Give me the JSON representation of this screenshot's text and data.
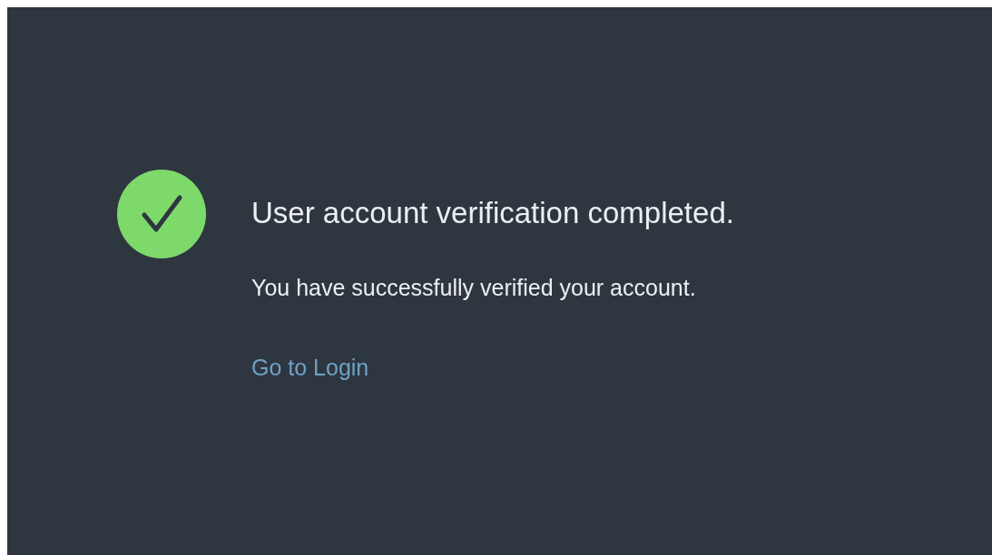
{
  "status": {
    "kind": "success"
  },
  "title": "User account verification completed.",
  "message": "You have successfully verified your account.",
  "link": "Go to Login"
}
